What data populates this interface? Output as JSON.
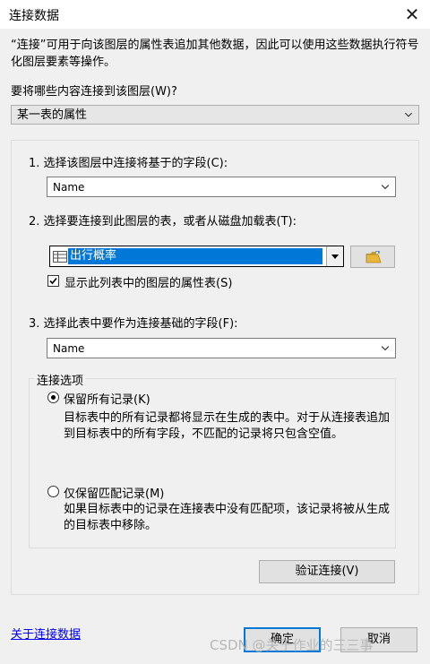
{
  "window": {
    "title": "连接数据",
    "close_glyph": "✕"
  },
  "description": "“连接”可用于向该图层的属性表追加其他数据，因此可以使用这些数据执行符号化图层要素等操作。",
  "join_what": {
    "label": "要将哪些内容连接到该图层(W)?",
    "selected": "某一表的属性"
  },
  "step1": {
    "label": "1. 选择该图层中连接将基于的字段(C):",
    "selected": "Name"
  },
  "step2": {
    "label": "2. 选择要连接到此图层的表，或者从磁盘加载表(T):",
    "selected": "出行概率",
    "show_attr_tables": {
      "label": "显示此列表中的图层的属性表(S)",
      "checked": true
    }
  },
  "step3": {
    "label": "3. 选择此表中要作为连接基础的字段(F):",
    "selected": "Name"
  },
  "join_options": {
    "legend": "连接选项",
    "keep_all": {
      "label": "保留所有记录(K)",
      "selected": true,
      "desc": "目标表中的所有记录都将显示在生成的表中。对于从连接表追加到目标表中的所有字段，不匹配的记录将只包含空值。"
    },
    "keep_matching": {
      "label": "仅保留匹配记录(M)",
      "selected": false,
      "desc": "如果目标表中的记录在连接表中没有匹配项，该记录将被从生成的目标表中移除。"
    }
  },
  "validate_button": "验证连接(V)",
  "about_link": "关于连接数据",
  "ok_button": "确定",
  "cancel_button": "取消",
  "watermark": "CSDN @关于作业的三三事",
  "colors": {
    "highlight": "#0078d7",
    "link": "#0000ee",
    "folder": "#e8b73a"
  },
  "icons": {
    "table_icon": "table-icon",
    "folder_icon": "open-folder-icon"
  }
}
